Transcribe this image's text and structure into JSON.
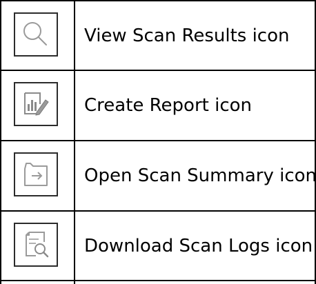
{
  "rows": [
    {
      "icon": "magnifier-icon",
      "label": "View Scan Results icon"
    },
    {
      "icon": "report-edit-icon",
      "label": "Create Report icon"
    },
    {
      "icon": "open-arrow-icon",
      "label": "Open Scan Summary icon"
    },
    {
      "icon": "document-search-icon",
      "label": "Download Scan Logs icon"
    }
  ],
  "colors": {
    "border": "#000000",
    "icon_stroke": "#9a9a9a",
    "icon_box_border": "#2b2b2b",
    "text": "#000000"
  }
}
